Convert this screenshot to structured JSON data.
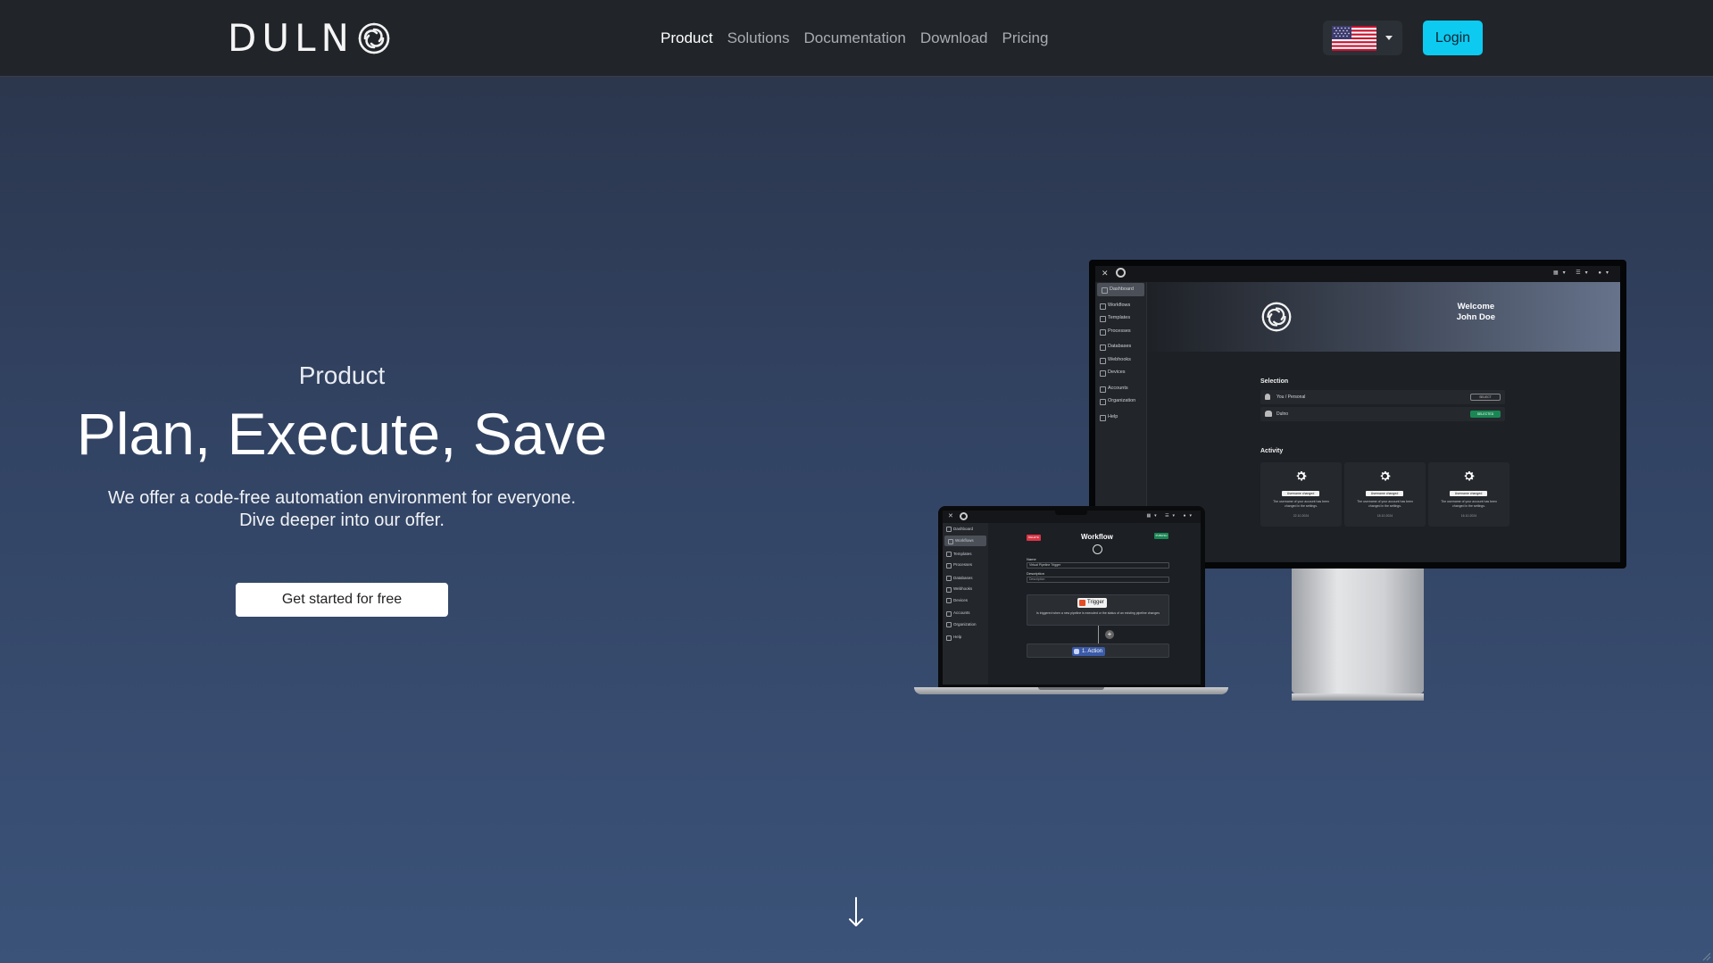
{
  "brand": {
    "name": "DULN"
  },
  "nav": {
    "links": [
      "Product",
      "Solutions",
      "Documentation",
      "Download",
      "Pricing"
    ],
    "active": "Product",
    "language_icon": "us-flag-icon",
    "login_label": "Login"
  },
  "colors": {
    "accent": "#0dcaf0",
    "navbar": "#212529",
    "bg_top": "#2a3449",
    "bg_bottom": "#3b5379"
  },
  "hero": {
    "eyebrow": "Product",
    "title": "Plan, Execute, Save",
    "description_line1": "We offer a code-free automation environment for everyone.",
    "description_line2": "Dive deeper into our offer.",
    "cta_label": "Get started for free"
  },
  "monitor_app": {
    "sidebar": [
      "Dashboard",
      "Workflows",
      "Templates",
      "Processes",
      "Databases",
      "Webhooks",
      "Devices",
      "Accounts",
      "Organization",
      "Help"
    ],
    "welcome_line1": "Welcome",
    "welcome_line2": "John Doe",
    "selection_label": "Selection",
    "selection_rows": [
      {
        "name": "You / Personal",
        "state": "SELECT"
      },
      {
        "name": "Dulno",
        "state": "SELECTED"
      }
    ],
    "activity_label": "Activity",
    "activity_cards": [
      {
        "tag": "Username changed",
        "text": "The username of your account has been changed in the settings.",
        "date": "22.10.2024"
      },
      {
        "tag": "Username changed",
        "text": "The username of your account has been changed in the settings.",
        "date": "18.10.2024"
      },
      {
        "tag": "Username changed",
        "text": "The username of your account has been changed in the settings.",
        "date": "16.10.2024"
      }
    ]
  },
  "laptop_app": {
    "sidebar": [
      "Dashboard",
      "Workflows",
      "Templates",
      "Processes",
      "Databases",
      "Webhooks",
      "Devices",
      "Accounts",
      "Organization",
      "Help"
    ],
    "title": "Workflow",
    "delete_label": "DELETE",
    "publish_label": "PUBLISH",
    "name_label": "Name",
    "name_value": "Virtual Pipeline Trigger",
    "description_label": "Description",
    "description_placeholder": "Description",
    "trigger_label": "Trigger",
    "trigger_text": "Is triggered when a new pipeline is executed or the status of an existing pipeline changes",
    "action_label": "1. Action"
  }
}
